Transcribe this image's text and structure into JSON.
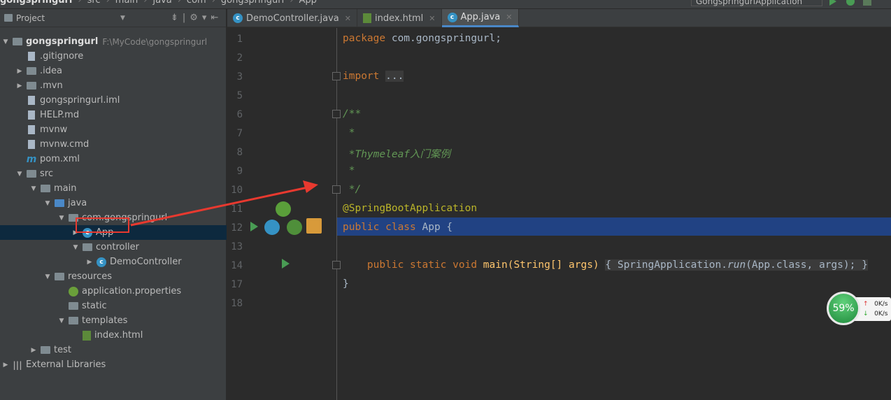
{
  "breadcrumb": [
    "gongspringurl",
    "src",
    "main",
    "java",
    "com",
    "gongspringurl",
    "App"
  ],
  "run_config": "GongspringurlApplication",
  "sidebar": {
    "title": "Project",
    "tree": [
      {
        "level": 0,
        "arrow": "open",
        "icon": "folder",
        "label": "gongspringurl",
        "extra": "F:\\MyCode\\gongspringurl",
        "bold": true
      },
      {
        "level": 1,
        "arrow": "",
        "icon": "file",
        "label": ".gitignore"
      },
      {
        "level": 1,
        "arrow": "closed",
        "icon": "folder",
        "label": ".idea"
      },
      {
        "level": 1,
        "arrow": "closed",
        "icon": "folder",
        "label": ".mvn"
      },
      {
        "level": 1,
        "arrow": "",
        "icon": "file",
        "label": "gongspringurl.iml"
      },
      {
        "level": 1,
        "arrow": "",
        "icon": "file",
        "label": "HELP.md"
      },
      {
        "level": 1,
        "arrow": "",
        "icon": "file",
        "label": "mvnw"
      },
      {
        "level": 1,
        "arrow": "",
        "icon": "file",
        "label": "mvnw.cmd"
      },
      {
        "level": 1,
        "arrow": "",
        "icon": "m",
        "label": "pom.xml"
      },
      {
        "level": 1,
        "arrow": "open",
        "icon": "folder",
        "label": "src"
      },
      {
        "level": 2,
        "arrow": "open",
        "icon": "folder",
        "label": "main"
      },
      {
        "level": 3,
        "arrow": "open",
        "icon": "folder blue",
        "label": "java"
      },
      {
        "level": 4,
        "arrow": "open",
        "icon": "folder",
        "label": "com.gongspringurl"
      },
      {
        "level": 5,
        "arrow": "closed",
        "icon": "cls",
        "label": "App",
        "selected": true
      },
      {
        "level": 5,
        "arrow": "open",
        "icon": "folder",
        "label": "controller"
      },
      {
        "level": 6,
        "arrow": "closed",
        "icon": "cls",
        "label": "DemoController"
      },
      {
        "level": 3,
        "arrow": "open",
        "icon": "folder",
        "label": "resources"
      },
      {
        "level": 4,
        "arrow": "",
        "icon": "spring",
        "label": "application.properties"
      },
      {
        "level": 4,
        "arrow": "",
        "icon": "folder",
        "label": "static"
      },
      {
        "level": 4,
        "arrow": "open",
        "icon": "folder",
        "label": "templates"
      },
      {
        "level": 5,
        "arrow": "",
        "icon": "html",
        "label": "index.html"
      },
      {
        "level": 2,
        "arrow": "closed",
        "icon": "folder",
        "label": "test"
      },
      {
        "level": 0,
        "arrow": "closed",
        "icon": "lib",
        "label": "External Libraries"
      }
    ]
  },
  "tabs": [
    {
      "label": "DemoController.java",
      "icon": "cls"
    },
    {
      "label": "index.html",
      "icon": "html"
    },
    {
      "label": "App.java",
      "icon": "cls",
      "active": true
    }
  ],
  "editor": {
    "line_numbers": [
      "1",
      "2",
      "3",
      "5",
      "6",
      "7",
      "8",
      "9",
      "10",
      "11",
      "12",
      "13",
      "14",
      "17",
      "18"
    ],
    "code": {
      "package_kw": "package",
      "package_name": " com.gongspringurl;",
      "import_kw": "import",
      "import_fold": "...",
      "c1": "/**",
      "c2": " *",
      "c3": " *Thymeleaf入门案例",
      "c4": " *",
      "c5": " */",
      "annotation": "@SpringBootApplication",
      "class_kw": "public class",
      "class_name": " App ",
      "brace": "{",
      "main_kw": "public static void",
      "main_sig": " main(String[] args) ",
      "main_body_open": "{ SpringApplication.",
      "run": "run",
      "main_args": "(App.",
      "class_kw2": "class",
      ", args); }": "",
      "main_end": ", args); }",
      "close": "}"
    }
  },
  "net_monitor": {
    "percent": "59%",
    "up": "0K/s",
    "down": "0K/s"
  }
}
